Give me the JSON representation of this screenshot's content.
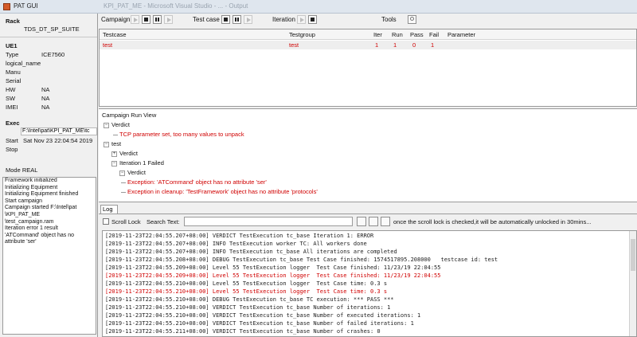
{
  "window": {
    "title": "PAT GUI",
    "faint_title": "KPI_PAT_ME - Microsoft Visual Studio - ... - Output"
  },
  "rack": {
    "title": "Rack",
    "name": "TDS_DT_SP_SUITE",
    "ue_title": "UE1",
    "fields": [
      {
        "label": "Type",
        "value": "ICE7560"
      },
      {
        "label": "logical_name",
        "value": ""
      },
      {
        "label": "Manu",
        "value": ""
      },
      {
        "label": "Serial",
        "value": ""
      },
      {
        "label": "HW",
        "value": "NA"
      },
      {
        "label": "SW",
        "value": "NA"
      },
      {
        "label": "IMEI",
        "value": "NA"
      }
    ],
    "exec_title": "Exec",
    "exec_path": "F:\\Intel\\pat\\KPI_PAT_ME\\tc",
    "start_label": "Start",
    "start_value": "Sat Nov 23 22:04:54 2019",
    "stop_label": "Stop",
    "mode": "Mode REAL"
  },
  "left_log": [
    "Framework initialized",
    "Initializing Equipment",
    "Initializing Equipment finished",
    "Start campaign",
    "Campaign started F:\\Intel\\pat",
    "\\KPI_PAT_ME",
    "\\test_campaign.ram",
    "Iteration error 1 result",
    "'ATCommand' object has no",
    "attribute 'ser'"
  ],
  "toolbar": {
    "campaign_label": "Campaign",
    "testcase_label": "Test case",
    "iteration_label": "Iteration",
    "tools_label": "Tools"
  },
  "table": {
    "headers": [
      "Testcase",
      "Testgroup",
      "Iter",
      "Run",
      "Pass",
      "Fail",
      "Parameter"
    ],
    "rows": [
      {
        "testcase": "test",
        "testgroup": "test",
        "iter": "1",
        "run": "1",
        "pass": "0",
        "fail": "1",
        "parameter": ""
      }
    ]
  },
  "runview": {
    "title": "Campaign Run View",
    "nodes": {
      "verdict1": "Verdict",
      "tcp_error": "TCP parameter set, too many values to unpack",
      "test": "test",
      "verdict2": "Verdict",
      "iteration": "Iteration 1 Failed",
      "verdict3": "Verdict",
      "exception1": "Exception: 'ATCommand' object has no attribute 'ser'",
      "exception2": "Exception in cleanup: 'TestFramework' object has no attribute 'protocols'"
    }
  },
  "log": {
    "tab": "Log",
    "scroll_lock": "Scroll Lock",
    "search_label": "Search Text:",
    "search_value": "",
    "hint": "once the scroll lock is checked,it will be automatically unlocked in 30mins...",
    "lines": [
      {
        "ts": "[2019-11-23T22:04:55.207+08:00]",
        "level": "VERDICT",
        "src": "TestExecution",
        "mod": "tc_base",
        "msg": "Iteration 1: ERROR",
        "red": false
      },
      {
        "ts": "[2019-11-23T22:04:55.207+08:00]",
        "level": "INFO",
        "src": "TestExecution",
        "mod": "worker",
        "msg": "TC: All workers done",
        "red": false
      },
      {
        "ts": "[2019-11-23T22:04:55.207+08:00]",
        "level": "INFO",
        "src": "TestExecution",
        "mod": "tc_base",
        "msg": "All iterations are completed",
        "red": false
      },
      {
        "ts": "[2019-11-23T22:04:55.208+08:00]",
        "level": "DEBUG",
        "src": "TestExecution",
        "mod": "tc_base",
        "msg": "Test Case finished: 1574517895.208000   testcase id: test",
        "red": false
      },
      {
        "ts": "[2019-11-23T22:04:55.209+08:00]",
        "level": "Level 55",
        "src": "TestExecution",
        "mod": "logger",
        "msg": " Test Case finished: 11/23/19 22:04:55",
        "red": false
      },
      {
        "ts": "[2019-11-23T22:04:55.209+08:00]",
        "level": "Level 55",
        "src": "TestExecution",
        "mod": "logger",
        "msg": " Test Case finished: 11/23/19 22:04:55",
        "red": true
      },
      {
        "ts": "[2019-11-23T22:04:55.210+08:00]",
        "level": "Level 55",
        "src": "TestExecution",
        "mod": "logger",
        "msg": " Test Case time: 0.3 s",
        "red": false
      },
      {
        "ts": "[2019-11-23T22:04:55.210+08:00]",
        "level": "Level 55",
        "src": "TestExecution",
        "mod": "logger",
        "msg": " Test Case time: 0.3 s",
        "red": true
      },
      {
        "ts": "[2019-11-23T22:04:55.210+08:00]",
        "level": "DEBUG",
        "src": "TestExecution",
        "mod": "tc_base",
        "msg": "TC execution: *** PASS ***",
        "red": false
      },
      {
        "ts": "[2019-11-23T22:04:55.210+08:00]",
        "level": "VERDICT",
        "src": "TestExecution",
        "mod": "tc_base",
        "msg": "Number of iterations: 1",
        "red": false
      },
      {
        "ts": "[2019-11-23T22:04:55.210+08:00]",
        "level": "VERDICT",
        "src": "TestExecution",
        "mod": "tc_base",
        "msg": "Number of executed iterations: 1",
        "red": false
      },
      {
        "ts": "[2019-11-23T22:04:55.210+08:00]",
        "level": "VERDICT",
        "src": "TestExecution",
        "mod": "tc_base",
        "msg": "Number of failed iterations: 1",
        "red": false
      },
      {
        "ts": "[2019-11-23T22:04:55.211+08:00]",
        "level": "VERDICT",
        "src": "TestExecution",
        "mod": "tc_base",
        "msg": "Number of crashes: 0",
        "red": false
      }
    ]
  }
}
